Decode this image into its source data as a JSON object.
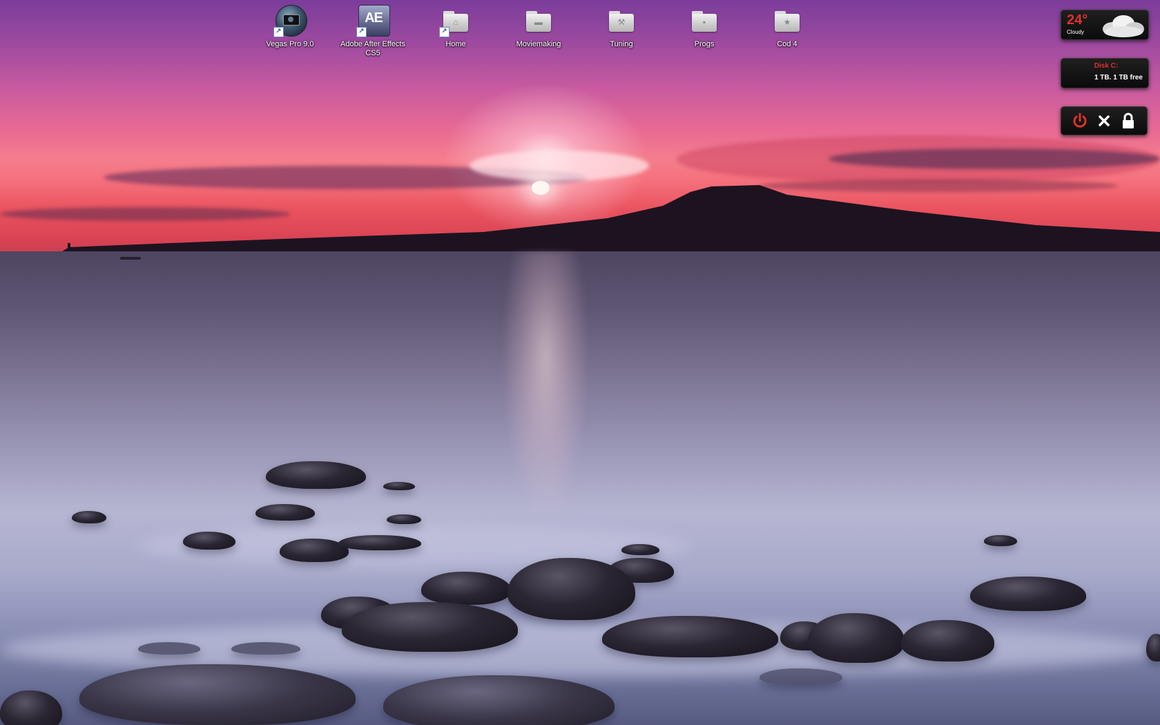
{
  "desktop": {
    "icons": [
      {
        "label": "Vegas Pro 9.0",
        "icon": "vegas-pro-icon",
        "shortcut": true
      },
      {
        "label": "Adobe After Effects CS5",
        "icon": "after-effects-icon",
        "shortcut": true
      },
      {
        "label": "Home",
        "icon": "folder-icon",
        "shortcut": true
      },
      {
        "label": "Moviemaking",
        "icon": "folder-icon",
        "shortcut": false
      },
      {
        "label": "Tuning",
        "icon": "folder-icon",
        "shortcut": false
      },
      {
        "label": "Progs",
        "icon": "folder-icon",
        "shortcut": false
      },
      {
        "label": "Cod 4",
        "icon": "folder-icon",
        "shortcut": false
      }
    ],
    "ae_glyph": "AE",
    "shortcut_glyph": "↗"
  },
  "gadgets": {
    "weather": {
      "temperature": "24°",
      "condition": "Cloudy",
      "icon": "cloud-icon"
    },
    "disk": {
      "title": "Disk C:",
      "info": "1 TB. 1 TB free"
    },
    "power": {
      "buttons": [
        "power-icon",
        "close-icon",
        "lock-icon"
      ]
    }
  },
  "colors": {
    "gadget_accent": "#e0302c",
    "gadget_bg": "#111111"
  }
}
